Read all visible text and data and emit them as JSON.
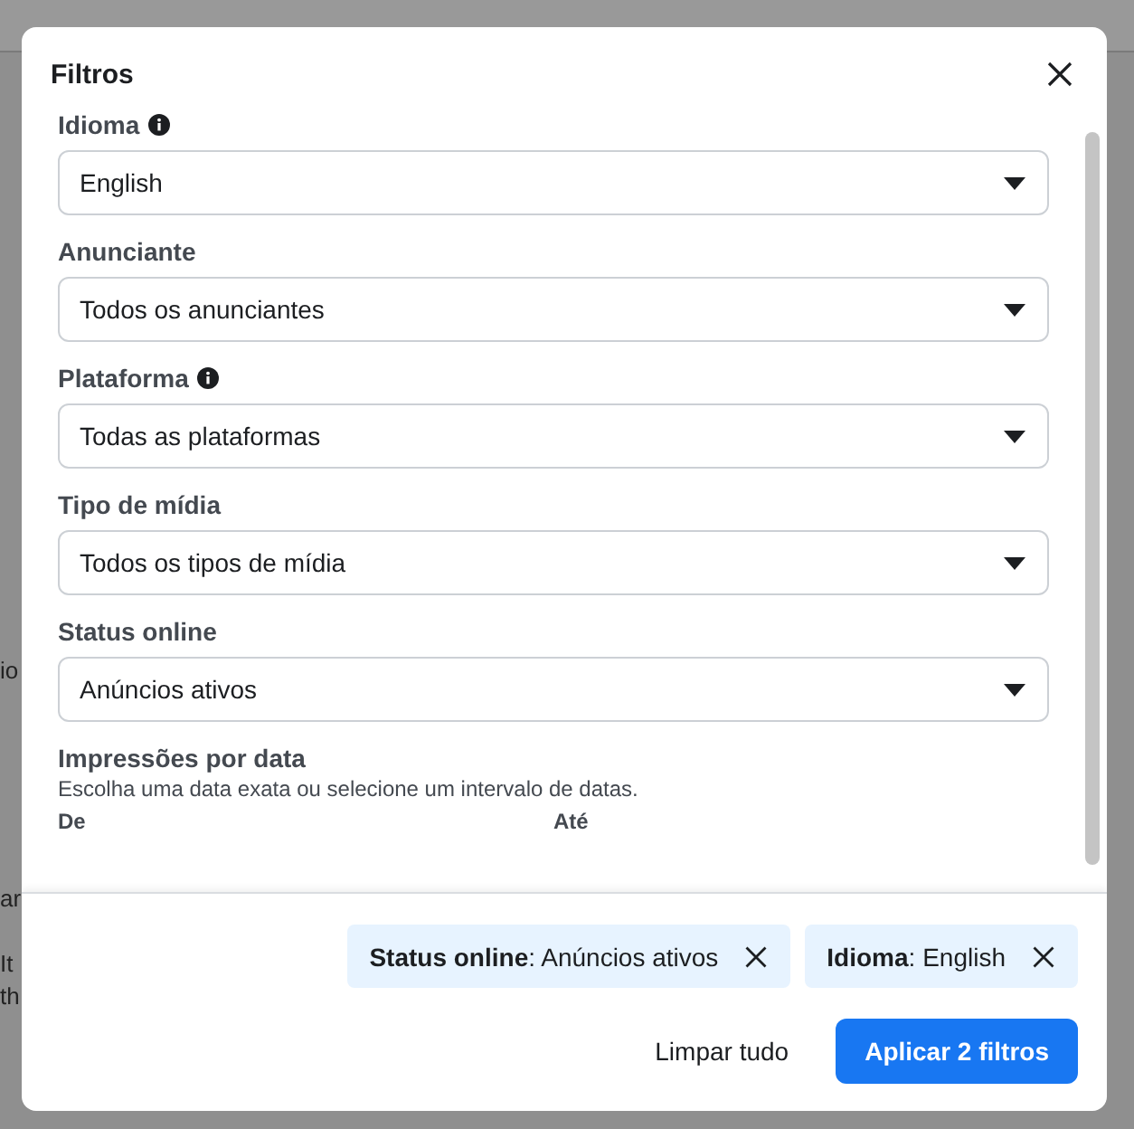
{
  "background_fragments": [
    "io",
    "ar",
    "It",
    "th"
  ],
  "dialog": {
    "title": "Filtros"
  },
  "fields": [
    {
      "label": "Idioma",
      "info": true,
      "value": "English"
    },
    {
      "label": "Anunciante",
      "info": false,
      "value": "Todos os anunciantes"
    },
    {
      "label": "Plataforma",
      "info": true,
      "value": "Todas as plataformas"
    },
    {
      "label": "Tipo de mídia",
      "info": false,
      "value": "Todos os tipos de mídia"
    },
    {
      "label": "Status online",
      "info": false,
      "value": "Anúncios ativos"
    }
  ],
  "date_filter": {
    "label": "Impressões por data",
    "hint": "Escolha uma data exata ou selecione um intervalo de datas.",
    "from_label": "De",
    "to_label": "Até"
  },
  "chips": [
    {
      "text": "**Status online**: Anúncios ativos"
    },
    {
      "text": "**Idioma**: English"
    }
  ],
  "buttons": {
    "clear": "Limpar tudo",
    "apply": "Aplicar 2 filtros"
  }
}
